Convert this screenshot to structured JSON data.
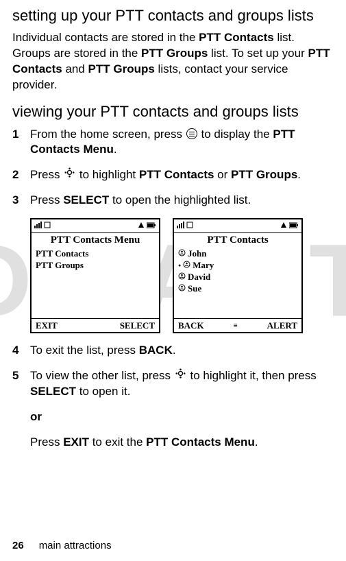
{
  "watermark": "DRAFT",
  "heading1": "setting up your PTT contacts and groups lists",
  "para1_a": "Individual contacts are stored in the ",
  "para1_b": "PTT Contacts",
  "para1_c": " list. Groups are stored in the ",
  "para1_d": "PTT Groups",
  "para1_e": " list. To set up your ",
  "para1_f": "PTT Contacts",
  "para1_g": " and ",
  "para1_h": "PTT Groups",
  "para1_i": " lists, contact your service provider.",
  "heading2": "viewing your PTT contacts and groups lists",
  "steps": {
    "s1": {
      "num": "1",
      "a": "From the home screen, press ",
      "b": " to display the ",
      "c": "PTT Contacts Menu",
      "d": "."
    },
    "s2": {
      "num": "2",
      "a": "Press ",
      "b": " to highlight ",
      "c": "PTT Contacts",
      "d": " or ",
      "e": "PTT Groups",
      "f": "."
    },
    "s3": {
      "num": "3",
      "a": "Press ",
      "b": "SELECT",
      "c": " to open the highlighted list."
    },
    "s4": {
      "num": "4",
      "a": "To exit the list, press ",
      "b": "BACK",
      "c": "."
    },
    "s5": {
      "num": "5",
      "a": "To view the other list, press ",
      "b": " to highlight it, then press ",
      "c": "SELECT",
      "d": " to open it."
    }
  },
  "or_label": "or",
  "last_a": "Press ",
  "last_b": "EXIT",
  "last_c": " to exit the ",
  "last_d": "PTT Contacts Menu",
  "last_e": ".",
  "screen1": {
    "title": "PTT Contacts Menu",
    "items": [
      "PTT Contacts",
      "PTT Groups"
    ],
    "left": "EXIT",
    "right": "SELECT"
  },
  "screen2": {
    "title": "PTT Contacts",
    "items": [
      "John",
      "Mary",
      "David",
      "Sue"
    ],
    "left": "BACK",
    "mid": "≡",
    "right": "ALERT"
  },
  "footer": {
    "page": "26",
    "section": "main attractions"
  }
}
